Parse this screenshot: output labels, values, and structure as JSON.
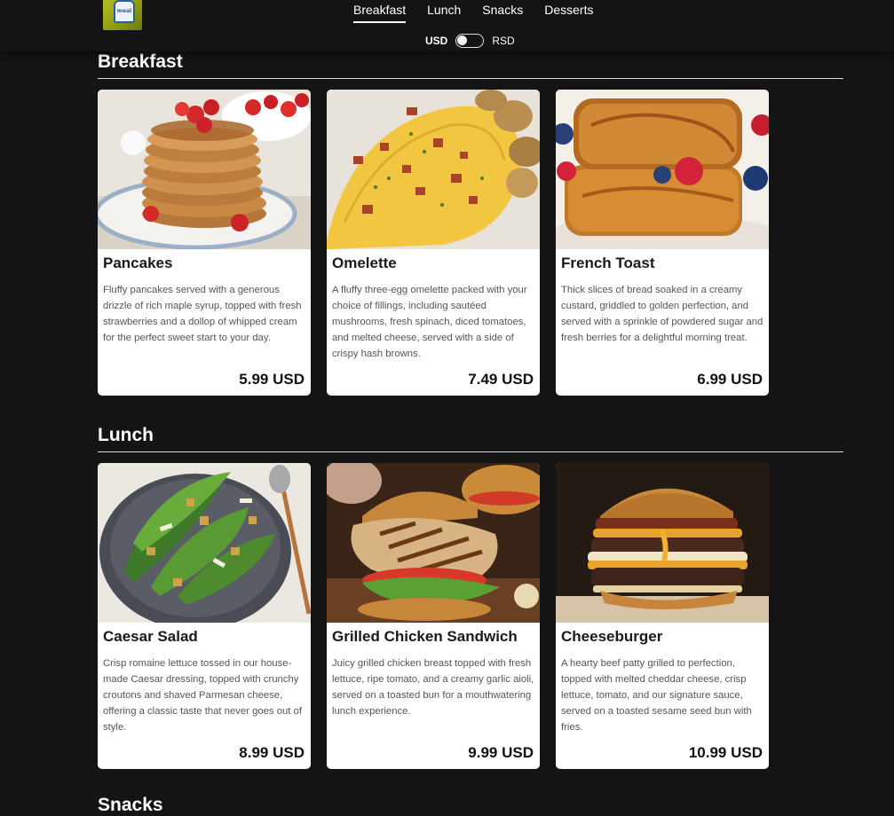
{
  "nav": {
    "items": [
      "Breakfast",
      "Lunch",
      "Snacks",
      "Desserts"
    ],
    "active": "Breakfast"
  },
  "logo": {
    "text": "meal"
  },
  "currency": {
    "left": "USD",
    "right": "RSD",
    "selected": "USD"
  },
  "sections": [
    {
      "title": "Breakfast",
      "cards": [
        {
          "title": "Pancakes",
          "image": "pancakes-photo",
          "description": "Fluffy pancakes served with a generous drizzle of rich maple syrup, topped with fresh strawberries and a dollop of whipped cream for the perfect sweet start to your day.",
          "price": "5.99 USD"
        },
        {
          "title": "Omelette",
          "image": "omelette-photo",
          "description": "A fluffy three-egg omelette packed with your choice of fillings, including sautéed mushrooms, fresh spinach, diced tomatoes, and melted cheese, served with a side of crispy hash browns.",
          "price": "7.49 USD"
        },
        {
          "title": "French Toast",
          "image": "french-toast-photo",
          "description": "Thick slices of bread soaked in a creamy custard, griddled to golden perfection, and served with a sprinkle of powdered sugar and fresh berries for a delightful morning treat.",
          "price": "6.99 USD"
        }
      ]
    },
    {
      "title": "Lunch",
      "cards": [
        {
          "title": "Caesar Salad",
          "image": "caesar-salad-photo",
          "description": "Crisp romaine lettuce tossed in our house-made Caesar dressing, topped with crunchy croutons and shaved Parmesan cheese, offering a classic taste that never goes out of style.",
          "price": "8.99 USD"
        },
        {
          "title": "Grilled Chicken Sandwich",
          "image": "chicken-sandwich-photo",
          "description": "Juicy grilled chicken breast topped with fresh lettuce, ripe tomato, and a creamy garlic aioli, served on a toasted bun for a mouthwatering lunch experience.",
          "price": "9.99 USD"
        },
        {
          "title": "Cheeseburger",
          "image": "cheeseburger-photo",
          "description": "A hearty beef patty grilled to perfection, topped with melted cheddar cheese, crisp lettuce, tomato, and our signature sauce, served on a toasted sesame seed bun with fries.",
          "price": "10.99 USD"
        }
      ]
    }
  ],
  "next_section": {
    "title": "Snacks"
  }
}
